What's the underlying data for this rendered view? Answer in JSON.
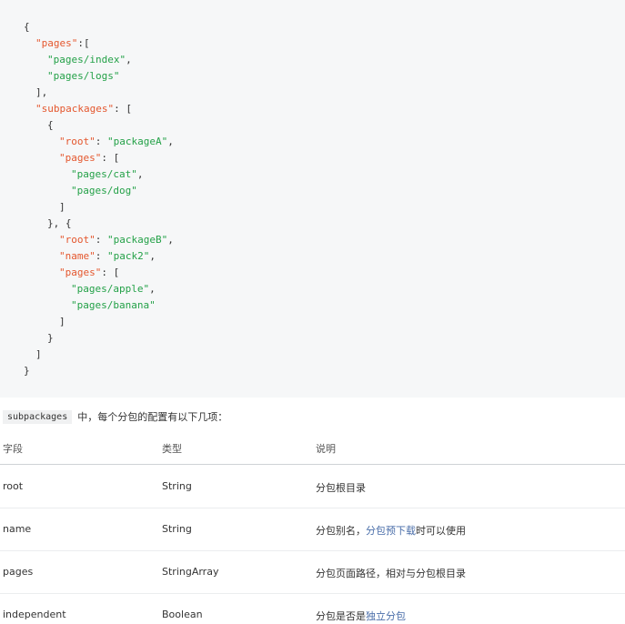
{
  "code_lines": [
    [
      {
        "t": "punc",
        "v": "{"
      }
    ],
    [
      {
        "t": "key",
        "v": "\"pages\""
      },
      {
        "t": "punc",
        "v": ":["
      }
    ],
    [
      {
        "t": "str",
        "v": "\"pages/index\""
      },
      {
        "t": "punc",
        "v": ","
      }
    ],
    [
      {
        "t": "str",
        "v": "\"pages/logs\""
      }
    ],
    [
      {
        "t": "punc",
        "v": "],"
      }
    ],
    [
      {
        "t": "key",
        "v": "\"subpackages\""
      },
      {
        "t": "punc",
        "v": ": ["
      }
    ],
    [
      {
        "t": "punc",
        "v": "{"
      }
    ],
    [
      {
        "t": "key",
        "v": "\"root\""
      },
      {
        "t": "punc",
        "v": ": "
      },
      {
        "t": "str",
        "v": "\"packageA\""
      },
      {
        "t": "punc",
        "v": ","
      }
    ],
    [
      {
        "t": "key",
        "v": "\"pages\""
      },
      {
        "t": "punc",
        "v": ": ["
      }
    ],
    [
      {
        "t": "str",
        "v": "\"pages/cat\""
      },
      {
        "t": "punc",
        "v": ","
      }
    ],
    [
      {
        "t": "str",
        "v": "\"pages/dog\""
      }
    ],
    [
      {
        "t": "punc",
        "v": "]"
      }
    ],
    [
      {
        "t": "punc",
        "v": "}, {"
      }
    ],
    [
      {
        "t": "key",
        "v": "\"root\""
      },
      {
        "t": "punc",
        "v": ": "
      },
      {
        "t": "str",
        "v": "\"packageB\""
      },
      {
        "t": "punc",
        "v": ","
      }
    ],
    [
      {
        "t": "key",
        "v": "\"name\""
      },
      {
        "t": "punc",
        "v": ": "
      },
      {
        "t": "str",
        "v": "\"pack2\""
      },
      {
        "t": "punc",
        "v": ","
      }
    ],
    [
      {
        "t": "key",
        "v": "\"pages\""
      },
      {
        "t": "punc",
        "v": ": ["
      }
    ],
    [
      {
        "t": "str",
        "v": "\"pages/apple\""
      },
      {
        "t": "punc",
        "v": ","
      }
    ],
    [
      {
        "t": "str",
        "v": "\"pages/banana\""
      }
    ],
    [
      {
        "t": "punc",
        "v": "]"
      }
    ],
    [
      {
        "t": "punc",
        "v": "}"
      }
    ],
    [
      {
        "t": "punc",
        "v": "]"
      }
    ],
    [
      {
        "t": "punc",
        "v": "}"
      }
    ]
  ],
  "code_indent_levels": [
    0,
    1,
    2,
    2,
    1,
    1,
    2,
    3,
    3,
    4,
    4,
    3,
    2,
    3,
    3,
    3,
    4,
    4,
    3,
    2,
    1,
    0
  ],
  "description": {
    "code": "subpackages",
    "text": "中，每个分包的配置有以下几项："
  },
  "table": {
    "headers": [
      "字段",
      "类型",
      "说明"
    ],
    "rows": [
      {
        "field": "root",
        "type": "String",
        "desc": [
          {
            "text": "分包根目录"
          }
        ]
      },
      {
        "field": "name",
        "type": "String",
        "desc": [
          {
            "text": "分包别名，"
          },
          {
            "text": "分包预下载",
            "link": true
          },
          {
            "text": "时可以使用"
          }
        ]
      },
      {
        "field": "pages",
        "type": "StringArray",
        "desc": [
          {
            "text": "分包页面路径，相对与分包根目录"
          }
        ]
      },
      {
        "field": "independent",
        "type": "Boolean",
        "desc": [
          {
            "text": "分包是否是"
          },
          {
            "text": "独立分包",
            "link": true
          }
        ]
      }
    ]
  },
  "colors": {
    "key": "#e4572e",
    "string": "#24a148",
    "link": "#4a6ea9",
    "code_bg": "#f6f7f8"
  }
}
